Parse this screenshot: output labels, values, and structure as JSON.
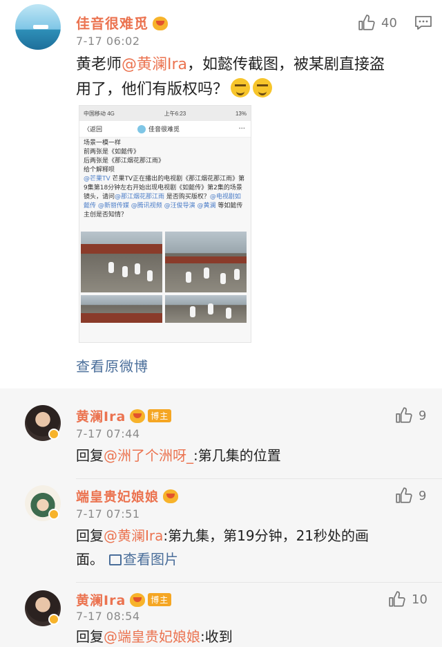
{
  "post": {
    "username": "佳音很难觅",
    "timestamp": "7-17 06:02",
    "like_count": "40",
    "text_prefix": "黄老师",
    "mention": "@黄澜Ira",
    "text_line1_rest": "，如懿传截图，被某剧直接盗",
    "text_line2": "用了，他们有版权吗？",
    "view_original": "查看原微博"
  },
  "embed": {
    "status_left": "中国移动 4G",
    "status_center": "上午6:23",
    "status_right": "13%",
    "nav_back": "〈返回",
    "nav_title": "佳音很难觅",
    "nav_more": "···",
    "lines": [
      "场景一模一样",
      "前两张是《如懿传》",
      "后两张是《那江烟花那江雨》",
      "给个解释呗"
    ],
    "para_lnk1": "@芒果TV",
    "para_1": " 芒果TV正在播出的电视剧《那江烟花那江雨》第9集第18分钟左右开始出现电视剧《如懿传》第2集的场景镜头，请问",
    "para_lnk2": "@那江烟花那江雨",
    "para_2": " 是否购买版权？",
    "para_lnk3": "@电视剧如懿传 @新丽传媒 @腾讯视频 @汪俊导演 @黄澜",
    "para_3": " 等如懿传主创是否知情？"
  },
  "comments": [
    {
      "username": "黄澜Ira",
      "badge": "博主",
      "timestamp": "7-17 07:44",
      "like_count": "9",
      "reply_prefix": "回复",
      "reply_mention": "@洲了个洲呀_",
      "reply_text": ":第几集的位置"
    },
    {
      "username": "端皇贵妃娘娘",
      "timestamp": "7-17 07:51",
      "like_count": "9",
      "reply_prefix": "回复",
      "reply_mention": "@黄澜Ira",
      "reply_text": ":第九集，第19分钟，21秒处的画",
      "reply_text_2": "面。",
      "view_pic": "查看图片"
    },
    {
      "username": "黄澜Ira",
      "badge": "博主",
      "timestamp": "7-17 08:54",
      "like_count": "10",
      "reply_prefix": "回复",
      "reply_mention": "@端皇贵妃娘娘",
      "reply_text": ":收到"
    }
  ],
  "colors": {
    "username": "#eb7350",
    "link": "#4a6e9a",
    "timestamp": "#8a8a8a",
    "comment_bg": "#f6f6f6"
  },
  "icons": [
    "thumbs-up-icon",
    "comment-more-icon",
    "vip-crown-icon",
    "verified-icon",
    "picture-icon"
  ]
}
